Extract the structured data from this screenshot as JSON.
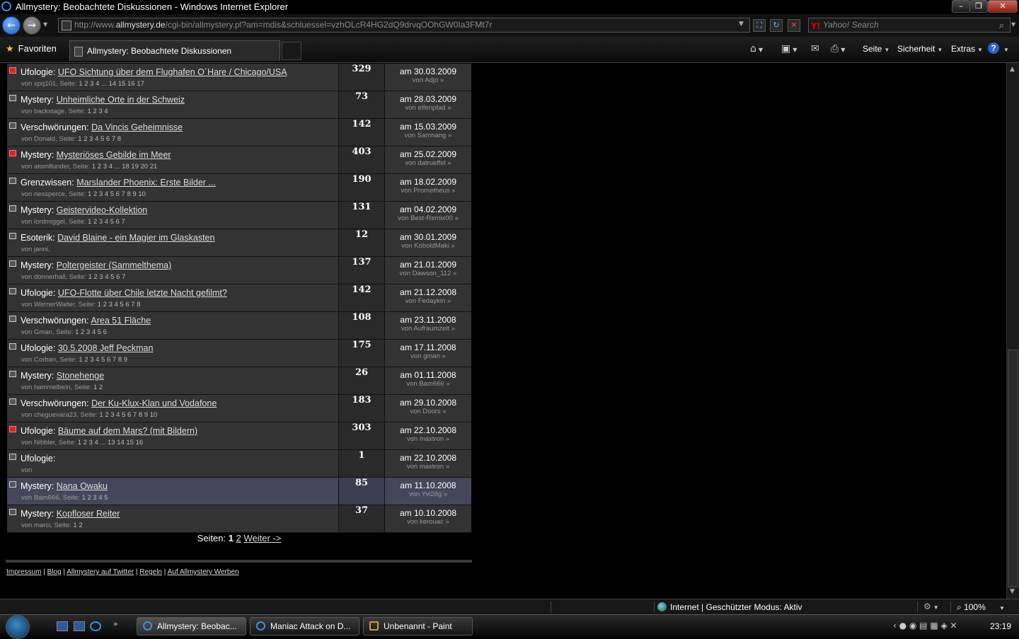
{
  "window": {
    "title": "Allmystery: Beobachtete Diskussionen - Windows Internet Explorer",
    "controls": [
      "–",
      "❐",
      "✕"
    ]
  },
  "nav": {
    "url_prefix": "http://www.",
    "url_domain": "allmystery.de",
    "url_rest": "/cgi-bin/allmystery.pl?am=mdis&schluessel=vzhOLcR4HG2dQ9drvqOOhGW0Ia3FMt7r",
    "search_placeholder": "Yahoo! Search",
    "search_brand": "Y!"
  },
  "toolbar": {
    "favorites_label": "Favoriten",
    "tab_title": "Allmystery: Beobachtete Diskussionen",
    "page_label": "Seite",
    "security_label": "Sicherheit",
    "extras_label": "Extras",
    "help_label": "?"
  },
  "threads": [
    {
      "category": "Ufologie:",
      "title": "UFO Sichtung über dem Flughafen O´Hare / Chicago/USA",
      "author": "xpq101",
      "pages": "1 2 3 4 ... 14 15 16 17",
      "count": "329",
      "date": "am 30.03.2009",
      "last": "von Adjo",
      "hot": true
    },
    {
      "category": "Mystery:",
      "title": "Unheimliche Orte in der Schweiz",
      "author": "backstage",
      "pages": "1 2 3 4",
      "count": "73",
      "date": "am 28.03.2009",
      "last": "von elfenpfad",
      "hot": false
    },
    {
      "category": "Verschwörungen:",
      "title": "Da Vincis Geheimnisse",
      "author": "Donald",
      "pages": "1 2 3 4 5 6 7 8",
      "count": "142",
      "date": "am 15.03.2009",
      "last": "von Samnang",
      "hot": false
    },
    {
      "category": "Mystery:",
      "title": "Mysteriöses Gebilde im Meer",
      "author": "atomflunder",
      "pages": "1 2 3 4 ... 18 19 20 21",
      "count": "403",
      "date": "am 25.02.2009",
      "last": "von datrueffel",
      "hot": true
    },
    {
      "category": "Grenzwissen:",
      "title": "Marslander Phoenix: Erste Bilder ...",
      "author": "nessperce",
      "pages": "1 2 3 4 5 6 7 8 9 10",
      "count": "190",
      "date": "am 18.02.2009",
      "last": "von Prometheus",
      "hot": false
    },
    {
      "category": "Mystery:",
      "title": "Geistervideo-Kollektion",
      "author": "lordmiggel",
      "pages": "1 2 3 4 5 6 7",
      "count": "131",
      "date": "am 04.02.2009",
      "last": "von Best-Remix00",
      "hot": false
    },
    {
      "category": "Esoterik:",
      "title": "David Blaine - ein Magier im Glaskasten",
      "author": "janni",
      "pages": "",
      "count": "12",
      "date": "am 30.01.2009",
      "last": "von KoboldMaki",
      "hot": false
    },
    {
      "category": "Mystery:",
      "title": "Poltergeister (Sammelthema)",
      "author": "donnerhall",
      "pages": "1 2 3 4 5 6 7",
      "count": "137",
      "date": "am 21.01.2009",
      "last": "von Dawson_112",
      "hot": false
    },
    {
      "category": "Ufologie:",
      "title": "UFO-Flotte über Chile letzte Nacht gefilmt?",
      "author": "WernerWalter",
      "pages": "1 2 3 4 5 6 7 8",
      "count": "142",
      "date": "am 21.12.2008",
      "last": "von Fedaykin",
      "hot": false
    },
    {
      "category": "Verschwörungen:",
      "title": "Area 51 Fläche",
      "author": "Gman",
      "pages": "1 2 3 4 5 6",
      "count": "108",
      "date": "am 23.11.2008",
      "last": "von Aufraumzeit",
      "hot": false
    },
    {
      "category": "Ufologie:",
      "title": "30.5.2008 Jeff Peckman",
      "author": "Corban",
      "pages": "1 2 3 4 5 6 7 8 9",
      "count": "175",
      "date": "am 17.11.2008",
      "last": "von gman",
      "hot": false
    },
    {
      "category": "Mystery:",
      "title": "Stonehenge",
      "author": "hammelbein",
      "pages": "1 2",
      "count": "26",
      "date": "am 01.11.2008",
      "last": "von Bam666",
      "hot": false
    },
    {
      "category": "Verschwörungen:",
      "title": "Der Ku-Klux-Klan und Vodafone",
      "author": "cheguevara23",
      "pages": "1 2 3 4 5 6 7 8 9 10",
      "count": "183",
      "date": "am 29.10.2008",
      "last": "von Doors",
      "hot": false
    },
    {
      "category": "Ufologie:",
      "title": "Bäume auf dem Mars? (mit Bildern)",
      "author": "Nibbler",
      "pages": "1 2 3 4 ... 13 14 15 16",
      "count": "303",
      "date": "am 22.10.2008",
      "last": "von maxtron",
      "hot": true
    },
    {
      "category": "Ufologie:",
      "title": "",
      "author": "",
      "pages": "",
      "count": "1",
      "date": "am 22.10.2008",
      "last": "von maxtron",
      "hot": false
    },
    {
      "category": "Mystery:",
      "title": "Nana Owaku",
      "author": "Bam666",
      "pages": "1 2 3 4 5",
      "count": "85",
      "date": "am 11.10.2008",
      "last": "von Yvi28g",
      "hot": false,
      "highlight": true
    },
    {
      "category": "Mystery:",
      "title": "Kopfloser Reiter",
      "author": "marci",
      "pages": "1 2",
      "count": "37",
      "date": "am 10.10.2008",
      "last": "von kerouac",
      "hot": false
    }
  ],
  "labels": {
    "von": "von",
    "seite": "Seite:",
    "arrow": "»"
  },
  "pager": {
    "label": "Seiten:",
    "current": "1",
    "next_page": "2",
    "next_label": "Weiter ->"
  },
  "footer": {
    "links": [
      "Impressum",
      "Blog",
      "Allmystery auf Twitter",
      "Regeln",
      "Auf Allmystery Werben"
    ],
    "separator": "|"
  },
  "status": {
    "zone": "Internet | Geschützter Modus: Aktiv",
    "zoom": "100%"
  },
  "taskbar": {
    "tasks": [
      "Allmystery: Beobac...",
      "Maniac Attack on D...",
      "Unbenannt - Paint"
    ],
    "clock": "23:19"
  }
}
